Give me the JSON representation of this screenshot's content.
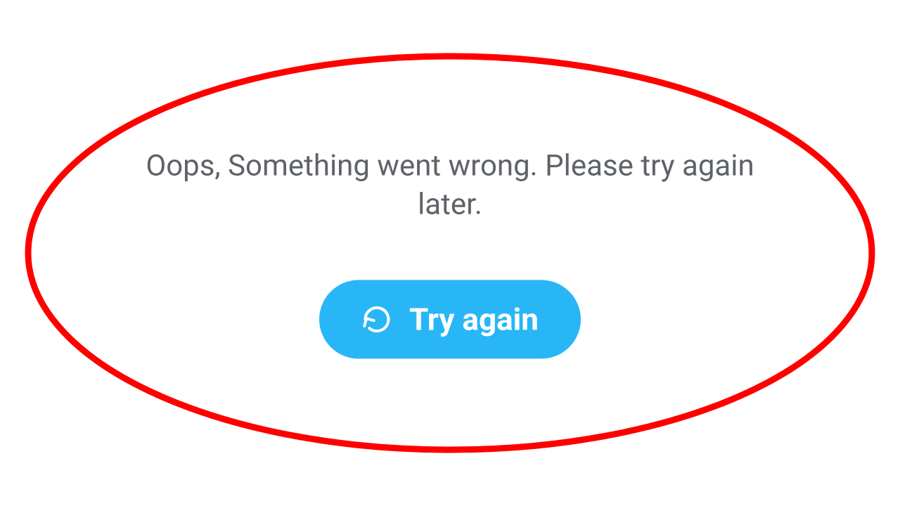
{
  "error": {
    "message": "Oops, Something went wrong. Please try again later.",
    "retry_label": "Try again"
  },
  "colors": {
    "accent": "#29b6f6",
    "annotation": "#ff0000",
    "text": "#5f6368"
  }
}
